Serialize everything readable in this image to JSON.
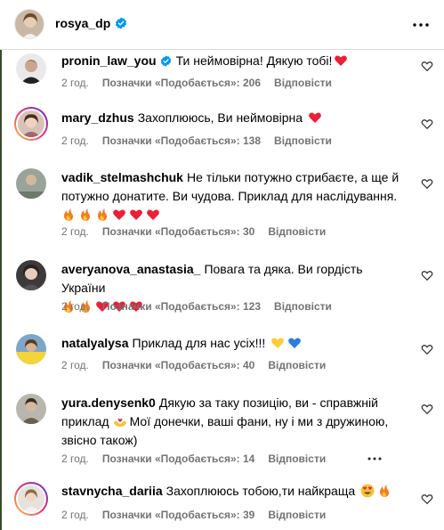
{
  "post_header": {
    "username": "rosya_dp",
    "verified_icon": "verified-badge-icon",
    "more_icon": "more-options-icon"
  },
  "comments": [
    {
      "username": "pronin_law_you",
      "verified": true,
      "text": "Ти неймовірна! Дякую тобі!",
      "emojis": [
        "red-heart"
      ],
      "time": "2 год.",
      "likes": "Позначки «Подобається»: 206",
      "reply": "Відповісти"
    },
    {
      "username": "mary_dzhus",
      "verified": false,
      "text": "Захоплююсь, Ви неймовірна",
      "emojis": [
        "red-heart"
      ],
      "time": "2 год.",
      "likes": "Позначки «Подобається»: 138",
      "reply": "Відповісти"
    },
    {
      "username": "vadik_stelmashchuk",
      "verified": false,
      "text": "Не тільки потужно стрибаєте, а ще й потужно донатите. Ви чудова. Приклад для наслідування.",
      "emojis": [
        "fire",
        "fire",
        "fire",
        "red-heart",
        "red-heart",
        "red-heart"
      ],
      "time": "2 год.",
      "likes": "Позначки «Подобається»: 30",
      "reply": "Відповісти"
    },
    {
      "username": "averyanova_anastasia_",
      "verified": false,
      "text": "Повага та дяка. Ви гордість України",
      "emojis": [
        "fire",
        "fire",
        "red-heart",
        "red-heart",
        "red-heart"
      ],
      "time": "2 год.",
      "likes": "Позначки «Подобається»: 123",
      "reply": "Відповісти"
    },
    {
      "username": "natalyalysa",
      "verified": false,
      "text": "Приклад для нас усіх!!!",
      "emojis": [
        "yellow-heart",
        "blue-heart"
      ],
      "time": "2 год.",
      "likes": "Позначки «Подобається»: 40",
      "reply": "Відповісти"
    },
    {
      "username": "yura.denysenk0",
      "verified": false,
      "text_before": "Дякую за таку позицію, ви - справжній приклад",
      "text_after": "Мої донечки, ваші фани, ну і ми з дружиною, звісно також)",
      "emojis": [
        "hands-heart"
      ],
      "time": "2 год.",
      "likes": "Позначки «Подобається»: 14",
      "reply": "Відповісти",
      "has_more": true
    },
    {
      "username": "stavnycha_dariia",
      "verified": false,
      "text": "Захоплююсь тобою,ти найкраща",
      "emojis": [
        "heart-eyes",
        "fire"
      ],
      "time": "2 год.",
      "likes": "Позначки «Подобається»: 39",
      "reply": "Відповісти"
    }
  ],
  "colors": {
    "meta_gray": "#737373",
    "verified_blue": "#0095f6",
    "heart_red": "#ed1f34"
  }
}
